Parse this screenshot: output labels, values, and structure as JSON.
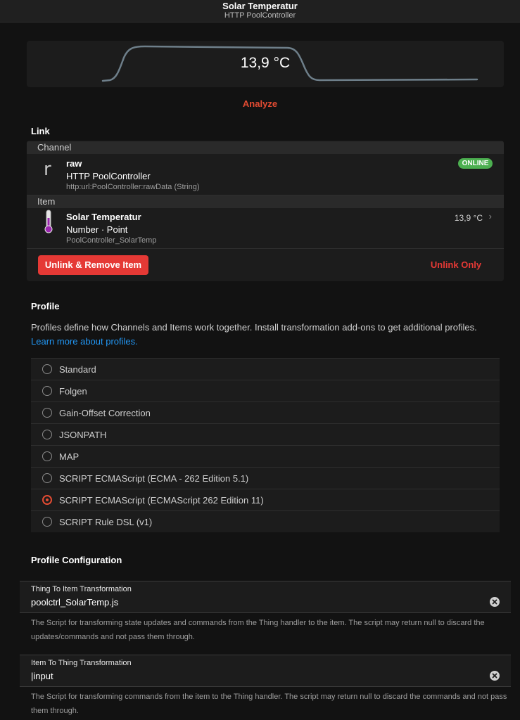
{
  "navbar": {
    "title": "Solar Temperatur",
    "subtitle": "HTTP PoolController"
  },
  "sparkline": {
    "value": "13,9 °C",
    "line_color": "#6e7f8a"
  },
  "analyze_label": "Analyze",
  "link": {
    "section_title": "Link",
    "channel_header": "Channel",
    "channel": {
      "icon_letter": "r",
      "title": "raw",
      "subtitle": "HTTP PoolController",
      "footer": "http:url:PoolController:rawData (String)",
      "badge": "ONLINE"
    },
    "item_header": "Item",
    "item": {
      "icon": "thermometer-icon",
      "title": "Solar Temperatur",
      "subtitle": "Number · Point",
      "footer": "PoolController_SolarTemp",
      "state": "13,9 °C"
    },
    "unlink_remove_label": "Unlink & Remove Item",
    "unlink_only_label": "Unlink Only"
  },
  "profile": {
    "section_title": "Profile",
    "description": "Profiles define how Channels and Items work together. Install transformation add-ons to get additional profiles.",
    "learn_more": "Learn more about profiles.",
    "options": [
      {
        "label": "Standard",
        "selected": false
      },
      {
        "label": "Folgen",
        "selected": false
      },
      {
        "label": "Gain-Offset Correction",
        "selected": false
      },
      {
        "label": "JSONPATH",
        "selected": false
      },
      {
        "label": "MAP",
        "selected": false
      },
      {
        "label": "SCRIPT ECMAScript (ECMA - 262 Edition 5.1)",
        "selected": false
      },
      {
        "label": "SCRIPT ECMAScript (ECMAScript 262 Edition 11)",
        "selected": true
      },
      {
        "label": "SCRIPT Rule DSL (v1)",
        "selected": false
      }
    ]
  },
  "profile_config": {
    "section_title": "Profile Configuration",
    "fields": [
      {
        "label": "Thing To Item Transformation",
        "value": "poolctrl_SolarTemp.js",
        "help": "The Script for transforming state updates and commands from the Thing handler to the item. The script may return null to discard the updates/commands and not pass them through."
      },
      {
        "label": "Item To Thing Transformation",
        "value": "|input",
        "help": "The Script for transforming commands from the item to the Thing handler. The script may return null to discard the commands and not pass them through."
      }
    ]
  },
  "colors": {
    "accent": "#e34b32",
    "danger": "#e53935",
    "online": "#4caf50",
    "link": "#2196f3"
  }
}
